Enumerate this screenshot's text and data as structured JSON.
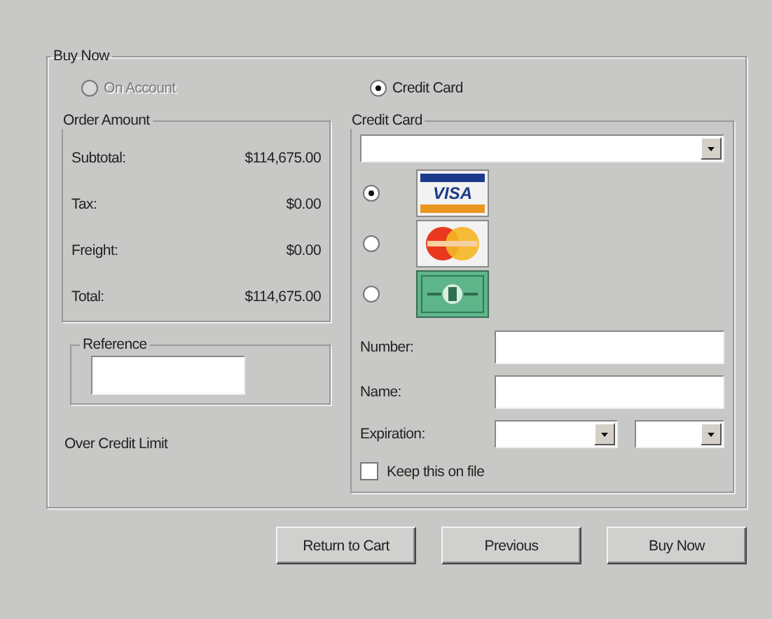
{
  "group_title": "Buy Now",
  "payment_methods": [
    {
      "label": "On Account",
      "selected": false,
      "disabled": true
    },
    {
      "label": "Credit Card",
      "selected": true,
      "disabled": false
    }
  ],
  "order_amount": {
    "title": "Order Amount",
    "rows": [
      {
        "label": "Subtotal:",
        "value": "$114,675.00"
      },
      {
        "label": "Tax:",
        "value": "$0.00"
      },
      {
        "label": "Freight:",
        "value": "$0.00"
      },
      {
        "label": "Total:",
        "value": "$114,675.00"
      }
    ]
  },
  "reference": {
    "title": "Reference"
  },
  "status_text": "Over Credit Limit",
  "credit_card": {
    "title": "Credit Card",
    "cards": [
      {
        "kind": "visa",
        "selected": true,
        "logo_text": "VISA"
      },
      {
        "kind": "mastercard",
        "selected": false
      },
      {
        "kind": "amex",
        "selected": false
      }
    ],
    "number_label": "Number:",
    "name_label": "Name:",
    "expiration_label": "Expiration:",
    "keep_on_file": {
      "label": "Keep this on file",
      "checked": false
    }
  },
  "buttons": [
    {
      "label": "Return to Cart"
    },
    {
      "label": "Previous"
    },
    {
      "label": "Buy Now"
    }
  ]
}
